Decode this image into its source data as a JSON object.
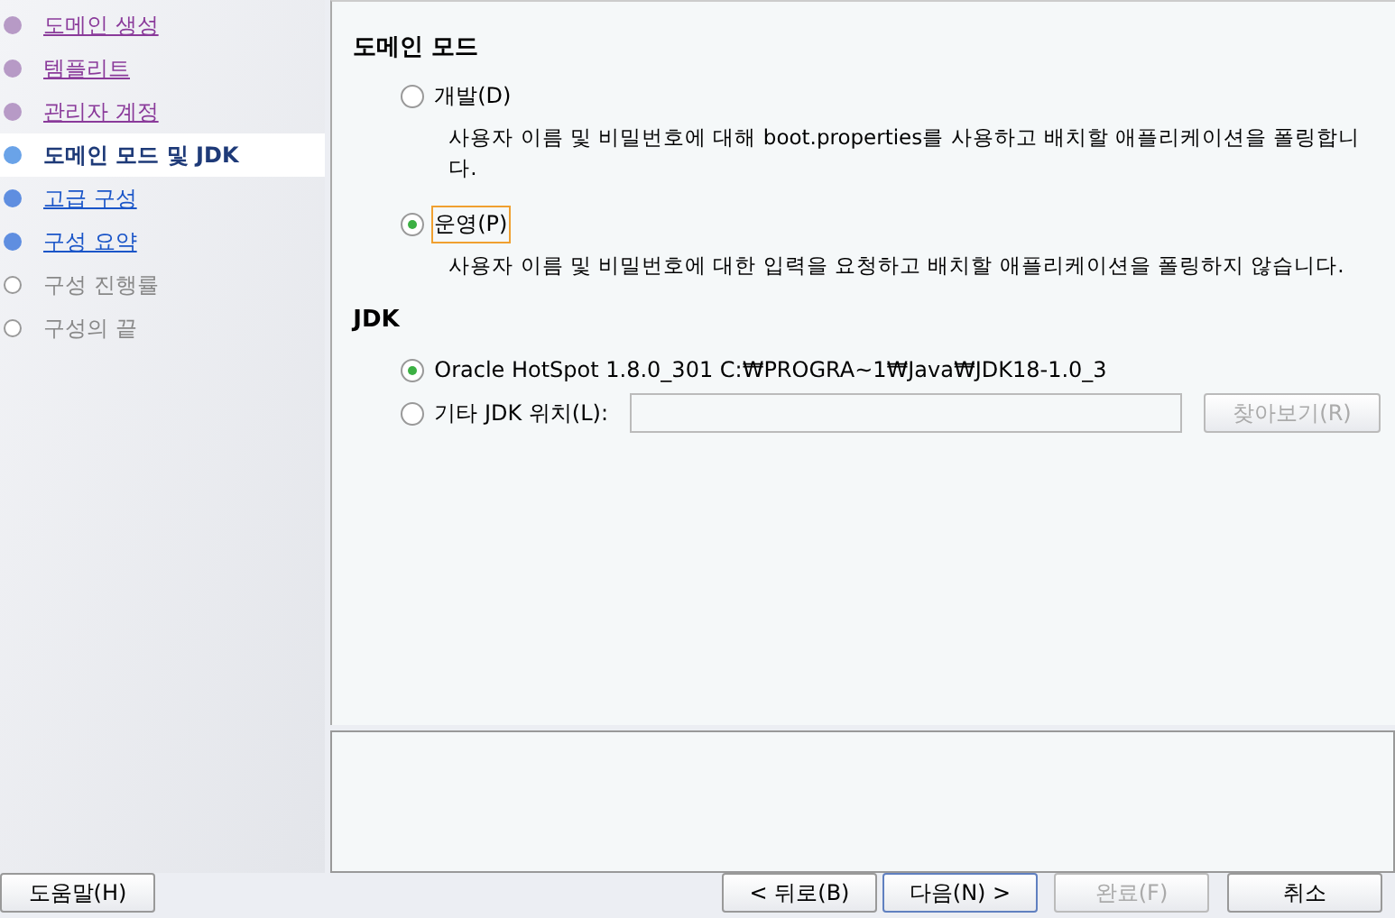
{
  "steps": [
    {
      "label": "도메인 생성",
      "kind": "done",
      "selected": false
    },
    {
      "label": "템플리트",
      "kind": "done",
      "selected": false
    },
    {
      "label": "관리자 계정",
      "kind": "done",
      "selected": false
    },
    {
      "label": "도메인 모드 및 JDK",
      "kind": "current",
      "selected": true
    },
    {
      "label": "고급 구성",
      "kind": "next",
      "selected": false
    },
    {
      "label": "구성 요약",
      "kind": "next",
      "selected": false
    },
    {
      "label": "구성 진행률",
      "kind": "pending",
      "selected": false
    },
    {
      "label": "구성의 끝",
      "kind": "pending",
      "selected": false
    }
  ],
  "domain_mode": {
    "title": "도메인 모드",
    "options": [
      {
        "label": "개발(D)",
        "description": "사용자 이름 및 비밀번호에 대해 boot.properties를 사용하고 배치할 애플리케이션을 폴링합니다.",
        "selected": false
      },
      {
        "label": "운영(P)",
        "description": "사용자 이름 및 비밀번호에 대한 입력을 요청하고 배치할 애플리케이션을 폴링하지 않습니다.",
        "selected": true
      }
    ]
  },
  "jdk": {
    "title": "JDK",
    "options": [
      {
        "label": "Oracle HotSpot 1.8.0_301 C:₩PROGRA~1₩Java₩JDK18-1.0_3",
        "selected": true
      },
      {
        "label": "기타 JDK 위치(L):",
        "selected": false
      }
    ],
    "browse_button": {
      "label": "찾아보기(R)",
      "disabled": true
    }
  },
  "buttons": [
    {
      "label": "도움말(H)",
      "disabled": false
    },
    {
      "label": "< 뒤로(B)",
      "disabled": false
    },
    {
      "label": "다음(N) >",
      "disabled": false
    },
    {
      "label": "완료(F)",
      "disabled": true
    },
    {
      "label": "취소",
      "disabled": false
    }
  ]
}
